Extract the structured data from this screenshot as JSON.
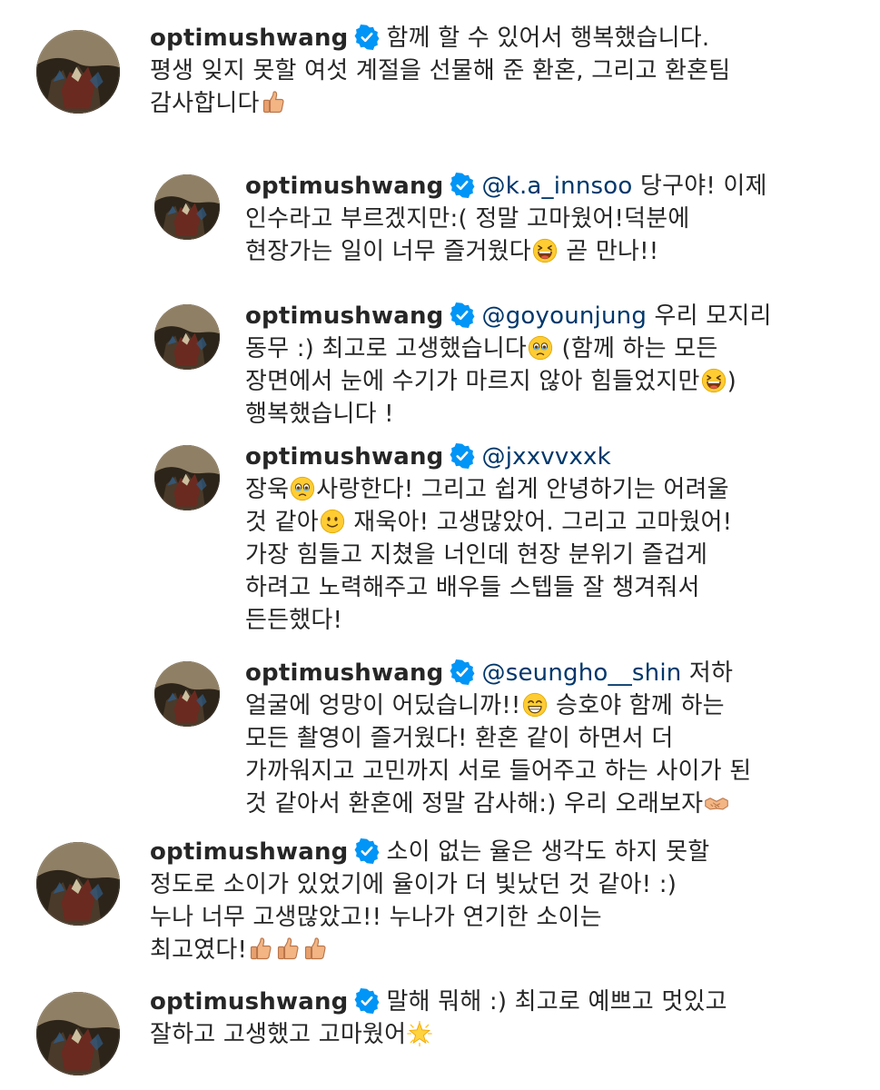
{
  "comments": [
    {
      "username": "optimushwang",
      "mention": "",
      "parts": [
        {
          "t": "함께 할 수 있어서 행복했습니다."
        },
        {
          "br": true
        },
        {
          "t": "평생 잊지 못할 여섯 계절을 선물해 준 환혼, 그리고 환혼팀"
        },
        {
          "br": true
        },
        {
          "t": "감사합니다"
        },
        {
          "emoji": "thumbs-up-icon"
        }
      ]
    },
    {
      "username": "optimushwang",
      "mention": "@k.a_innsoo",
      "parts": [
        {
          "t": " 당구야! 이제"
        },
        {
          "br": true
        },
        {
          "t": "인수라고 부르겠지만:( 정말 고마웠어!덕분에"
        },
        {
          "br": true
        },
        {
          "t": "현장가는 일이 너무 즐거웠다"
        },
        {
          "emoji": "laughing-face-icon"
        },
        {
          "t": " 곧 만나!!"
        }
      ]
    },
    {
      "username": "optimushwang",
      "mention": "@goyounjung",
      "parts": [
        {
          "t": " 우리 모지리"
        },
        {
          "br": true
        },
        {
          "t": "동무 :) 최고로 고생했습니다"
        },
        {
          "emoji": "holding-back-tears-icon"
        },
        {
          "t": " (함께 하는 모든"
        },
        {
          "br": true
        },
        {
          "t": "장면에서 눈에 수기가 마르지 않아 힘들었지만"
        },
        {
          "emoji": "laughing-face-icon"
        },
        {
          "t": ")"
        },
        {
          "br": true
        },
        {
          "t": "행복했습니다 !"
        }
      ]
    },
    {
      "username": "optimushwang",
      "mention": "@jxxvvxxk",
      "parts": [
        {
          "br": true
        },
        {
          "t": "장욱"
        },
        {
          "emoji": "holding-back-tears-icon"
        },
        {
          "t": "사랑한다! 그리고 쉽게 안녕하기는 어려울"
        },
        {
          "br": true
        },
        {
          "t": "것 같아"
        },
        {
          "emoji": "slightly-smiling-face-icon"
        },
        {
          "t": " 재욱아! 고생많았어. 그리고 고마웠어!"
        },
        {
          "br": true
        },
        {
          "t": "가장 힘들고 지쳤을 너인데 현장 분위기 즐겁게"
        },
        {
          "br": true
        },
        {
          "t": "하려고 노력해주고 배우들 스텝들 잘 챙겨줘서"
        },
        {
          "br": true
        },
        {
          "t": "든든했다!"
        }
      ]
    },
    {
      "username": "optimushwang",
      "mention": "@seungho__shin",
      "parts": [
        {
          "t": " 저하"
        },
        {
          "br": true
        },
        {
          "t": "얼굴에 엉망이 어딨습니까!!"
        },
        {
          "emoji": "grinning-face-icon"
        },
        {
          "t": " 승호야 함께 하는"
        },
        {
          "br": true
        },
        {
          "t": "모든 촬영이 즐거웠다! 환혼 같이 하면서 더"
        },
        {
          "br": true
        },
        {
          "t": "가까워지고 고민까지 서로 들어주고 하는 사이가 된"
        },
        {
          "br": true
        },
        {
          "t": "것 같아서 환혼에 정말 감사해:) 우리 오래보자"
        },
        {
          "emoji": "handshake-icon"
        }
      ]
    },
    {
      "username": "optimushwang",
      "mention": "",
      "parts": [
        {
          "t": "소이 없는 율은 생각도 하지 못할"
        },
        {
          "br": true
        },
        {
          "t": "정도로 소이가 있었기에 율이가 더 빛났던 것 같아! :)"
        },
        {
          "br": true
        },
        {
          "t": "누나 너무 고생많았고!! 누나가 연기한 소이는"
        },
        {
          "br": true
        },
        {
          "t": "최고였다!"
        },
        {
          "emoji": "thumbs-up-icon"
        },
        {
          "emoji": "thumbs-up-icon"
        },
        {
          "emoji": "thumbs-up-icon"
        }
      ]
    },
    {
      "username": "optimushwang",
      "mention": "",
      "parts": [
        {
          "t": "말해 뭐해 :) 최고로 예쁘고 멋있고"
        },
        {
          "br": true
        },
        {
          "t": "잘하고 고생했고 고마웠어"
        },
        {
          "emoji": "glowing-star-icon"
        }
      ]
    }
  ],
  "colors": {
    "text": "#262626",
    "mention": "#00376b",
    "verified": "#0095f6",
    "background": "#ffffff"
  }
}
